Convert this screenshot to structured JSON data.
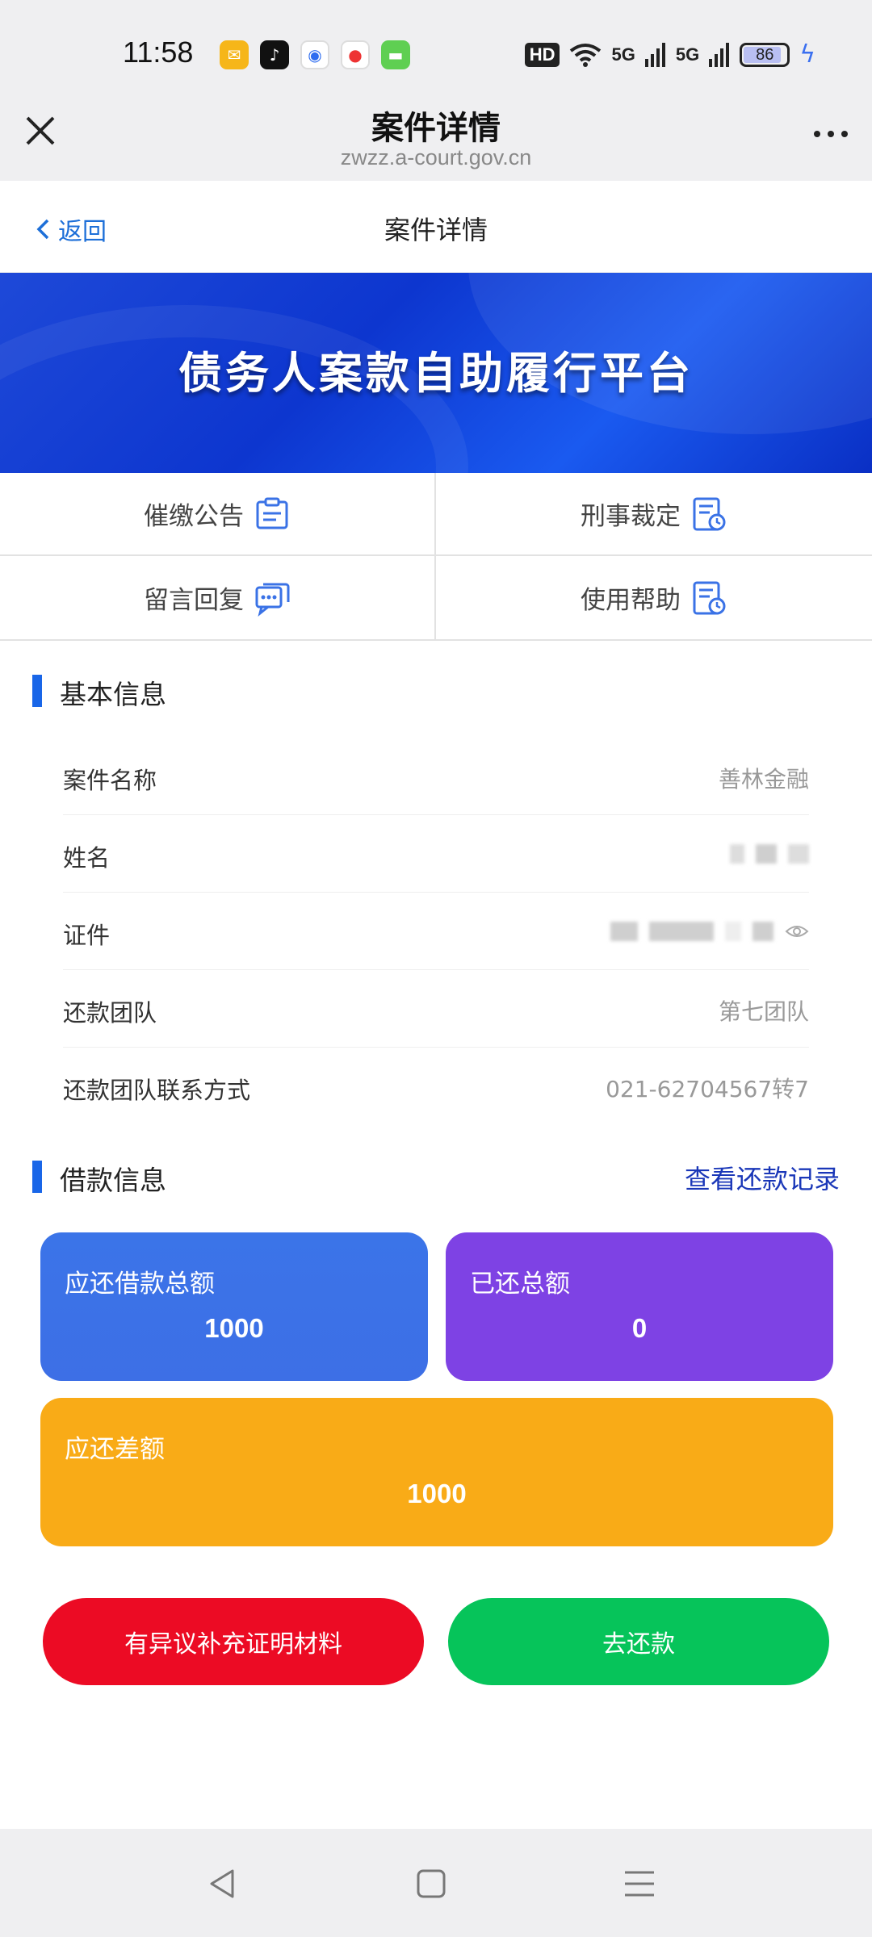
{
  "status_bar": {
    "time": "11:58",
    "app_icons": [
      "mail-icon",
      "tiktok-icon",
      "browser-icon",
      "maps-icon",
      "messages-icon"
    ],
    "hd_label": "HD",
    "signal1": "5G",
    "signal2": "5G",
    "battery": "86"
  },
  "browser": {
    "title": "案件详情",
    "url": "zwzz.a-court.gov.cn"
  },
  "page_nav": {
    "back_label": "返回",
    "title": "案件详情"
  },
  "banner": {
    "title": "债务人案款自助履行平台"
  },
  "menu": [
    {
      "label": "催缴公告",
      "icon": "notice-icon"
    },
    {
      "label": "刑事裁定",
      "icon": "ruling-icon"
    },
    {
      "label": "留言回复",
      "icon": "message-icon"
    },
    {
      "label": "使用帮助",
      "icon": "help-icon"
    }
  ],
  "basic_info": {
    "title": "基本信息",
    "rows": [
      {
        "label": "案件名称",
        "value": "善林金融"
      },
      {
        "label": "姓名",
        "value": ""
      },
      {
        "label": "证件",
        "value": ""
      },
      {
        "label": "还款团队",
        "value": "第七团队"
      },
      {
        "label": "还款团队联系方式",
        "value": "021-62704567转7"
      }
    ]
  },
  "loan_info": {
    "title": "借款信息",
    "link": "查看还款记录",
    "cards": {
      "total": {
        "label": "应还借款总额",
        "value": "1000"
      },
      "paid": {
        "label": "已还总额",
        "value": "0"
      },
      "diff": {
        "label": "应还差额",
        "value": "1000"
      }
    }
  },
  "actions": {
    "dispute": "有异议补充证明材料",
    "pay": "去还款"
  },
  "colors": {
    "accent": "#1966e8",
    "card_blue": "#3d6fe6",
    "card_purple": "#7e42e4",
    "card_orange": "#f9ab17",
    "btn_red": "#ec0b24",
    "btn_green": "#06c45a"
  }
}
